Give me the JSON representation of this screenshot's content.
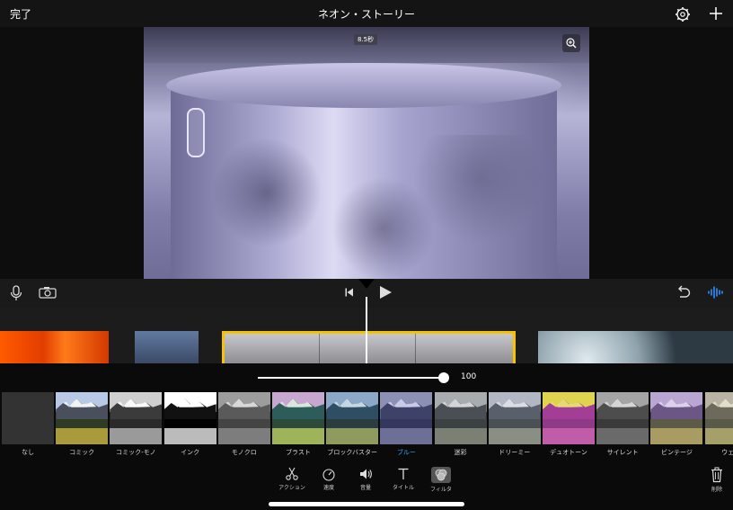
{
  "topbar": {
    "done_label": "完了",
    "project_title": "ネオン・ストーリー"
  },
  "viewer": {
    "clip_duration": "8.5秒"
  },
  "playback": {
    "play_icon": "play-icon",
    "rewind_icon": "skip-to-start-icon"
  },
  "filter_intensity": {
    "value_label": "100",
    "value": 1.0
  },
  "filters": [
    {
      "label": "なし"
    },
    {
      "label": "コミック"
    },
    {
      "label": "コミック-モノ"
    },
    {
      "label": "インク"
    },
    {
      "label": "モノクロ"
    },
    {
      "label": "ブラスト"
    },
    {
      "label": "ブロックバスター"
    },
    {
      "label": "ブルー",
      "selected": true
    },
    {
      "label": "迷彩"
    },
    {
      "label": "ドリーミー"
    },
    {
      "label": "デュオトーン"
    },
    {
      "label": "サイレント"
    },
    {
      "label": "ビンテージ"
    },
    {
      "label": "ウェス"
    }
  ],
  "toolbar": {
    "action_label": "アクション",
    "speed_label": "速度",
    "volume_label": "音量",
    "title_label": "タイトル",
    "filter_label": "フィルタ",
    "delete_label": "削除"
  },
  "colors": {
    "selection_border": "#f5c400",
    "selected_filter": "#3aa3ff"
  }
}
